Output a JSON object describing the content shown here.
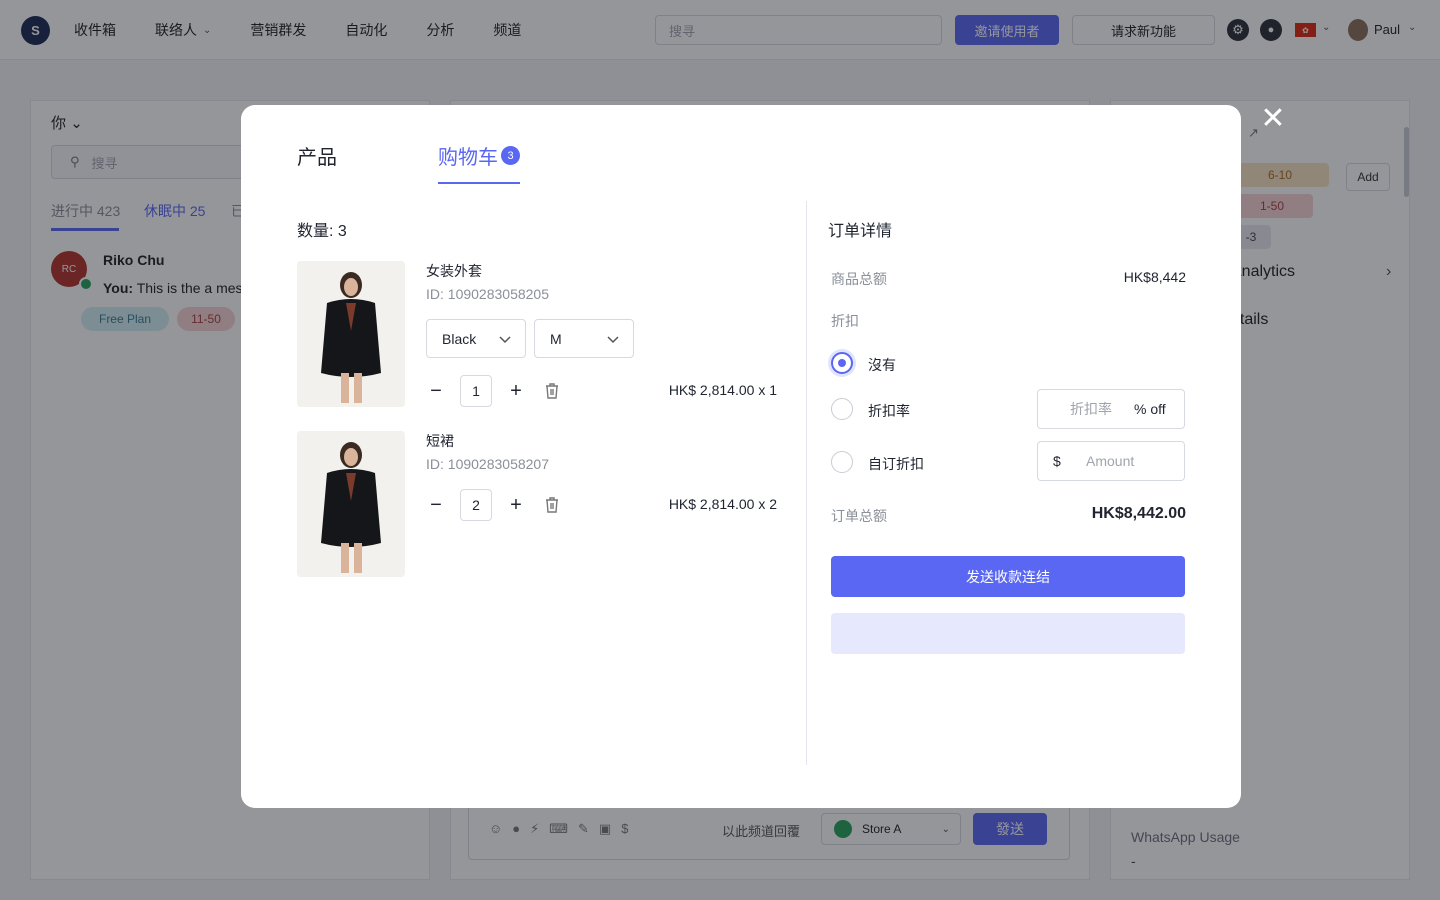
{
  "topbar": {
    "logo_letter": "S",
    "nav": [
      {
        "label": "收件箱"
      },
      {
        "label": "联络人"
      },
      {
        "label": "营销群发"
      },
      {
        "label": "自动化"
      },
      {
        "label": "分析"
      },
      {
        "label": "频道"
      }
    ],
    "search_placeholder": "搜寻",
    "invite_label": "邀请使用者",
    "feature_label": "请求新功能",
    "user_name": "Paul"
  },
  "left_panel": {
    "filter_label": "你",
    "search_placeholder": "搜寻",
    "tabs": [
      {
        "label": "进行中 423"
      },
      {
        "label": "休眠中 25"
      },
      {
        "label": "已"
      }
    ],
    "conversation": {
      "initials": "RC",
      "name": "Riko Chu",
      "sender": "You:",
      "preview": "This is the a mes",
      "tags": [
        "Free Plan",
        "11-50"
      ]
    }
  },
  "composer": {
    "hint": "以此频道回覆",
    "store": "Store A",
    "send_label": "發送"
  },
  "right_panel": {
    "tags": [
      "6-10",
      "1-50",
      "-3"
    ],
    "add_label": "Add",
    "analytics_label": "Analytics",
    "details_label": "etails",
    "usage_label": "WhatsApp Usage",
    "usage_value": "-"
  },
  "modal": {
    "tabs": {
      "products": "产品",
      "cart": "购物车",
      "cart_count": "3"
    },
    "quantity_heading": "数量: 3",
    "items": [
      {
        "name": "女装外套",
        "id": "ID: 1090283058205",
        "color": "Black",
        "size": "M",
        "quantity": "1",
        "line_price": "HK$ 2,814.00 x 1"
      },
      {
        "name": "短裙",
        "id": "ID: 1090283058207",
        "quantity": "2",
        "line_price": "HK$ 2,814.00 x 2"
      }
    ],
    "order": {
      "title": "订单详情",
      "subtotal_label": "商品总额",
      "subtotal_value": "HK$8,442",
      "discount_label": "折扣",
      "options": [
        {
          "label": "沒有",
          "checked": true
        },
        {
          "label": "折扣率",
          "checked": false
        },
        {
          "label": "自订折扣",
          "checked": false
        }
      ],
      "rate_placeholder": "折扣率",
      "rate_suffix": "% off",
      "amount_prefix": "$",
      "amount_placeholder": "Amount",
      "total_label": "订单总额",
      "total_value": "HK$8,442.00",
      "send_link_label": "发送收款连结"
    }
  },
  "colors": {
    "accent": "#5a67f2",
    "accent_light": "#e6e8fd",
    "text": "#1f2430",
    "muted": "#8a8f99"
  },
  "icons": [
    "close-icon",
    "search-icon",
    "chevron-down-icon",
    "minus-icon",
    "plus-icon",
    "trash-icon",
    "gear-icon",
    "bell-icon",
    "flag-icon",
    "external-link-icon",
    "chevron-right-icon",
    "whatsapp-icon"
  ]
}
